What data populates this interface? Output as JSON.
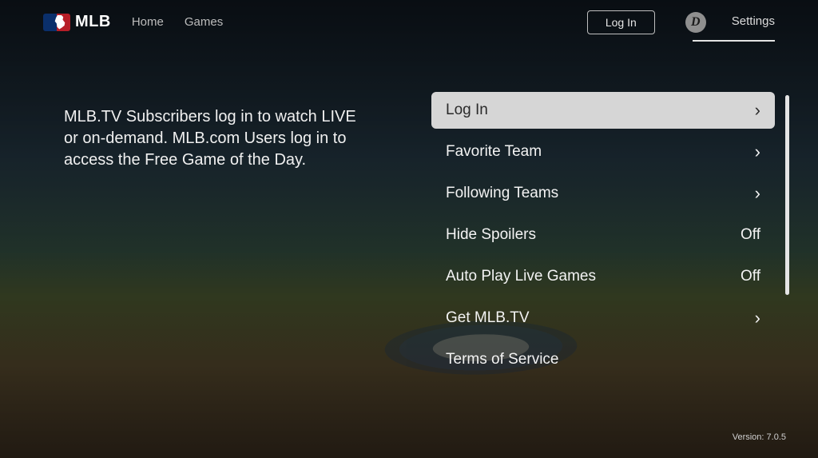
{
  "header": {
    "brand": "MLB",
    "nav": {
      "home": "Home",
      "games": "Games"
    },
    "login": "Log In",
    "team_badge_letter": "D",
    "settings": "Settings"
  },
  "description": "MLB.TV Subscribers log in to watch LIVE or on-demand. MLB.com Users log in to access the Free Game of the Day.",
  "settings": {
    "items": [
      {
        "label": "Log In",
        "value": "",
        "chevron": true,
        "selected": true
      },
      {
        "label": "Favorite Team",
        "value": "",
        "chevron": true,
        "selected": false
      },
      {
        "label": "Following Teams",
        "value": "",
        "chevron": true,
        "selected": false
      },
      {
        "label": "Hide Spoilers",
        "value": "Off",
        "chevron": false,
        "selected": false
      },
      {
        "label": "Auto Play Live Games",
        "value": "Off",
        "chevron": false,
        "selected": false
      },
      {
        "label": "Get MLB.TV",
        "value": "",
        "chevron": true,
        "selected": false
      },
      {
        "label": "Terms of Service",
        "value": "",
        "chevron": false,
        "selected": false
      }
    ]
  },
  "version": "Version: 7.0.5",
  "chevron_glyph": "›"
}
